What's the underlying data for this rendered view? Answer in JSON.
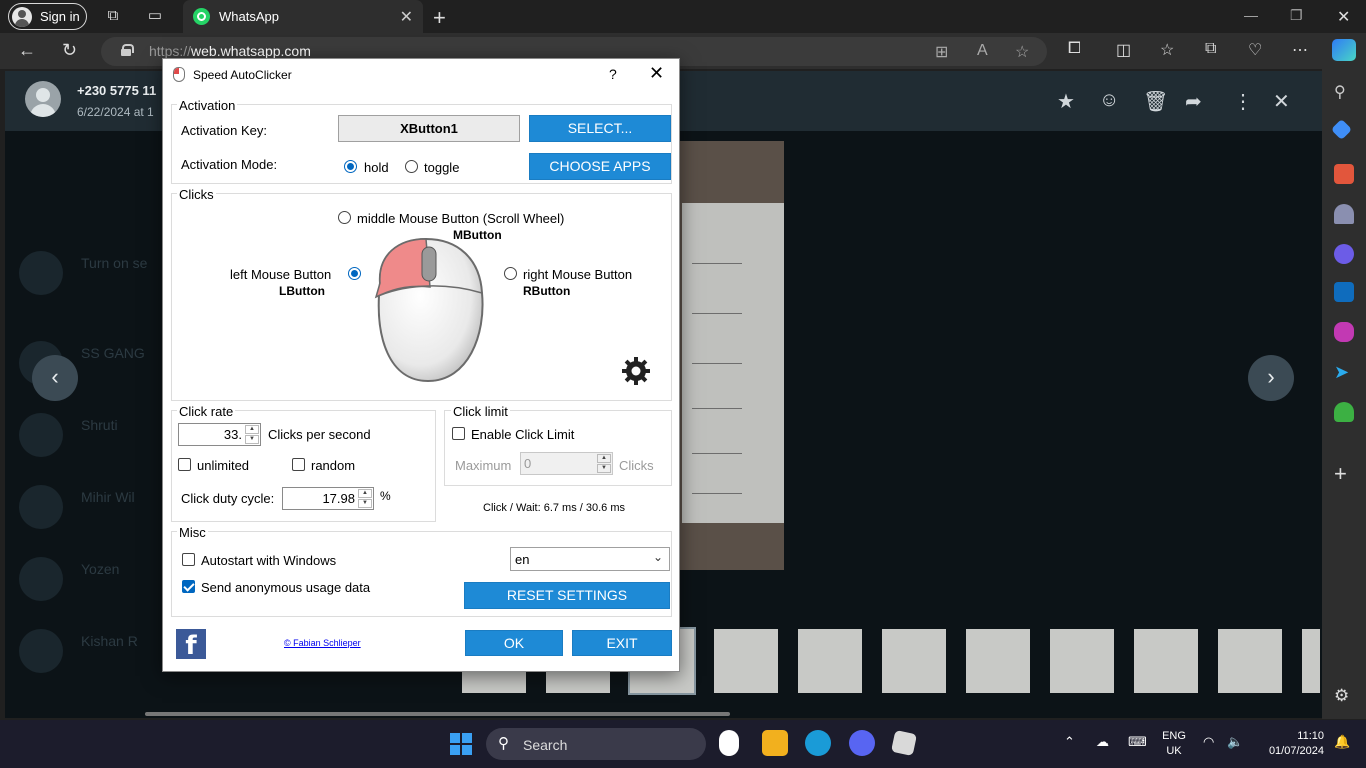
{
  "browser": {
    "sign_in": "Sign in",
    "tab_title": "WhatsApp",
    "url_scheme": "https://",
    "url_host": "web.whatsapp.com"
  },
  "whatsapp": {
    "contact_name": "+230 5775 11",
    "contact_date": "6/22/2024 at 1",
    "chat_list": [
      "Turn on se",
      "SS GANG",
      "Shruti",
      "Mihir Wil",
      "Yozen",
      "Kishan R"
    ]
  },
  "dialog": {
    "title": "Speed AutoClicker",
    "help": "?",
    "close": "✕",
    "activation": {
      "group_title": "Activation",
      "key_label": "Activation Key:",
      "key_value": "XButton1",
      "select_button": "SELECT...",
      "mode_label": "Activation Mode:",
      "mode_hold": "hold",
      "mode_toggle": "toggle",
      "choose_apps_button": "CHOOSE APPS",
      "selected_mode": "hold"
    },
    "clicks": {
      "group_title": "Clicks",
      "middle_label": "middle Mouse Button (Scroll Wheel)",
      "middle_code": "MButton",
      "left_label": "left Mouse Button",
      "left_code": "LButton",
      "right_label": "right Mouse Button",
      "right_code": "RButton",
      "selected_button": "left"
    },
    "click_rate": {
      "group_title": "Click rate",
      "rate_value": "33.",
      "rate_unit": "Clicks per second",
      "unlimited_label": "unlimited",
      "random_label": "random",
      "duty_label": "Click duty cycle:",
      "duty_value": "17.98",
      "duty_unit": "%"
    },
    "click_limit": {
      "group_title": "Click limit",
      "enable_label": "Enable Click Limit",
      "maximum_label": "Maximum",
      "maximum_value": "0",
      "clicks_label": "Clicks",
      "timing": "Click / Wait: 6.7 ms / 30.6 ms"
    },
    "misc": {
      "group_title": "Misc",
      "autostart_label": "Autostart with Windows",
      "usage_label": "Send anonymous usage data",
      "language": "en",
      "reset_button": "RESET SETTINGS"
    },
    "footer": {
      "facebook": "f",
      "author_link": "© Fabian Schlieper",
      "ok_button": "OK",
      "exit_button": "EXIT"
    }
  },
  "taskbar": {
    "search": "Search",
    "lang_1": "ENG",
    "lang_2": "UK",
    "time": "11:10",
    "date": "01/07/2024"
  },
  "colors": {
    "accent_blue": "#1e8ad6",
    "whatsapp_green": "#25d366",
    "facebook_blue": "#3b5998"
  }
}
